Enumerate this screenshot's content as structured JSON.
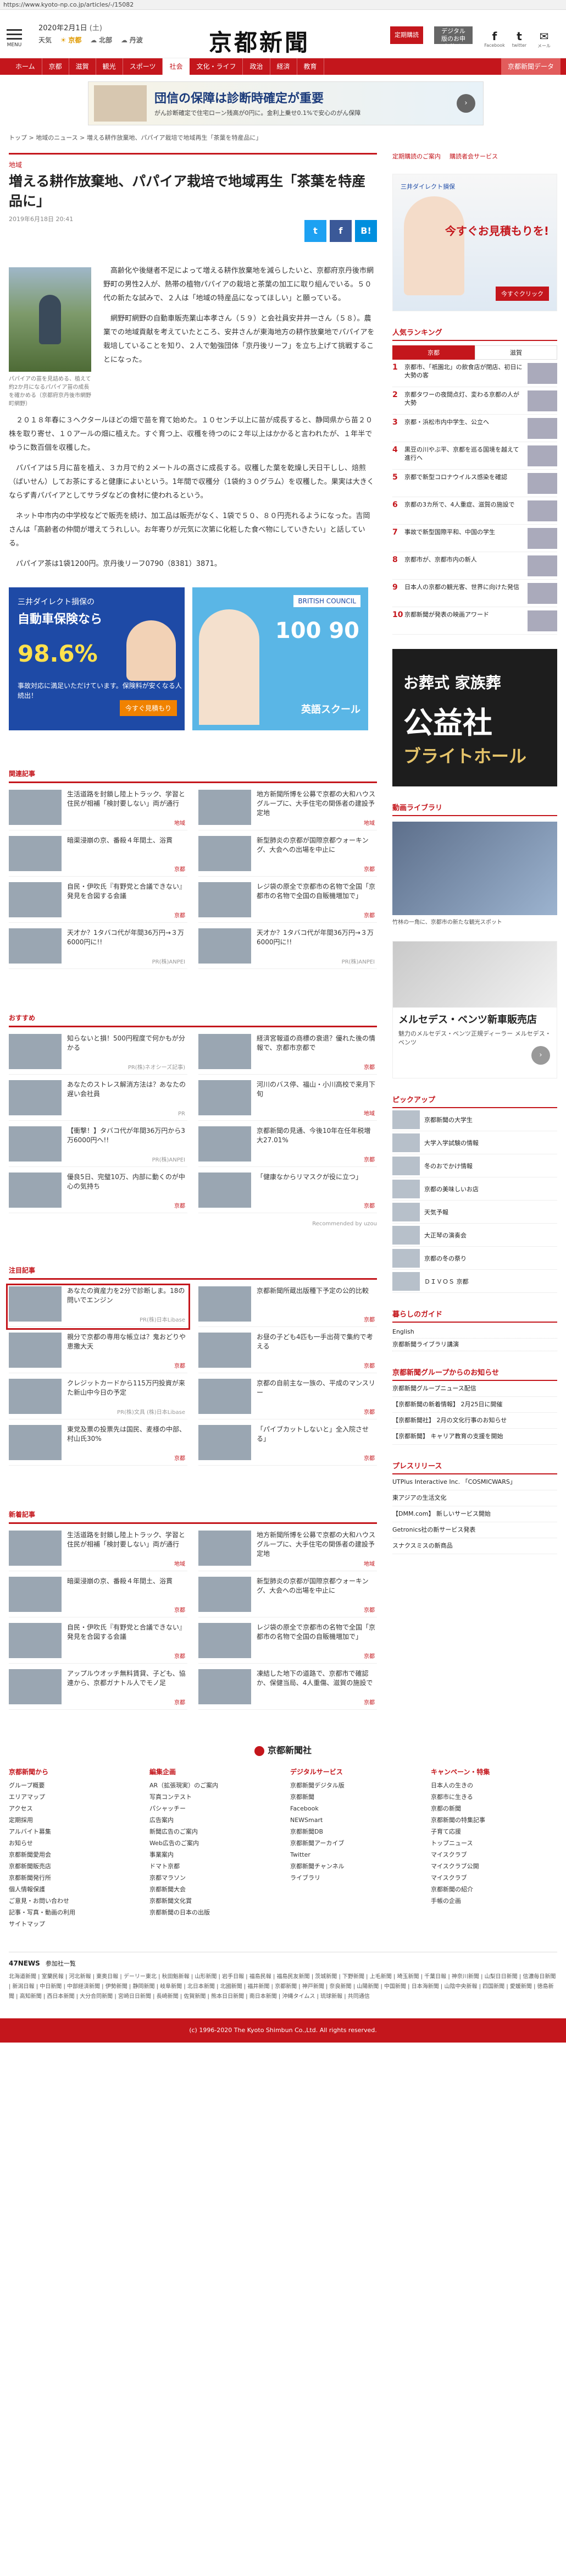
{
  "url": "https://www.kyoto-np.co.jp/articles/-/15082",
  "header": {
    "date": "2020年2月1日",
    "weekday": "(土)",
    "weather": [
      "天気",
      "京都",
      "北部",
      "丹波"
    ],
    "logo": "京都新聞",
    "btn_subscribe": "定期購読",
    "btn_digital": "デジタル版のお申し込み",
    "social": [
      {
        "glyph": "f",
        "label": "Facebook"
      },
      {
        "glyph": "t",
        "label": "twitter"
      },
      {
        "glyph": "✉",
        "label": "メール"
      }
    ]
  },
  "nav": [
    "ホーム",
    "京都",
    "滋賀",
    "観光",
    "スポーツ",
    "社会",
    "文化・ライフ",
    "政治",
    "経済",
    "教育",
    "京都新聞データ"
  ],
  "nav_active": 5,
  "top_ad": {
    "t1": "団信の保障は診断時確定が重要",
    "t2": "がん診断確定で住宅ローン残高が0円に。金利上乗せ0.1%で安心のがん保障"
  },
  "breadcrumb": "トップ > 地域のニュース > 増える耕作放棄地、パパイア栽培で地域再生「茶葉を特産品に」",
  "article": {
    "category": "地域",
    "title": "増える耕作放棄地、パパイア栽培で地域再生「茶葉を特産品に」",
    "date": "2019年6月18日 20:41",
    "share": [
      "t",
      "f",
      "B!"
    ],
    "caption": "パパイアの苗を見詰める、植えて約2か月になるパパイア苗の成長を確かめる（京都府京丹後市網野町網野）",
    "paragraphs": [
      "高齢化や後継者不足によって増える耕作放棄地を減らしたいと、京都府京丹後市網野町の男性2人が、熱帯の植物パパイアの栽培と茶葉の加工に取り組んでいる。５０代の新たな試みで、２人は「地域の特産品になってほしい」と願っている。",
      "網野町網野の自動車販売業山本孝さん（５９）と会社員安井井一さん（５８）。農業での地域貢献を考えていたところ、安井さんが東海地方の耕作放棄地でパパイアを栽培していることを知り、２人で勉強団体「京丹後リーフ」を立ち上げて挑戦することになった。",
      "２０１８年春に３ヘクタールほどの畑で苗を育て始めた。１０センチ以上に苗が成長すると、静岡県から苗２０株を取り寄せ、１０アールの畑に植えた。すぐ育つ上、収穫を待つのに２年以上はかかると言われたが、１年半でゆうに数百個を収穫した。",
      "パパイアは５月に苗を植え、３カ月で約２メートルの高さに成長する。収穫した葉を乾燥し天日干しし、焙煎（ばいせん）してお茶にすると健康によいという。1年間で収穫分（1袋約３０グラム）を収穫した。果実は大きくならず青パパイアとしてサラダなどの食材に使われるという。",
      "ネット中市内の中学校などで販売を続け、加工品は販売がなく、1袋で５０、８０円売れるようになった。吉岡さんは「高齢者の仲間が増えてうれしい。お年寄りが元気に次第に化粧した食べ物にしていきたい」と話している。",
      "パパイア茶は1袋1200円。京丹後リーフ0790（8381）3871。"
    ]
  },
  "mid_ads": {
    "a1": {
      "s1": "三井ダイレクト損保の",
      "s2": "自動車保険なら",
      "s3": "98.6%",
      "s4": "事故対応に満足いただけています。保険料が安くなる人続出！",
      "btn": "今すぐ見積もり"
    },
    "a2": {
      "s1": "BRITISH COUNCIL",
      "big": "100 90",
      "s5": "英語スクール"
    }
  },
  "sections": [
    {
      "title": "関連記事",
      "cards": [
        {
          "text": "生活道路を封鎖し陸上トラック、学習と住民が相補「検討要しない」両が通行",
          "tag": "地域",
          "cls": "t1c"
        },
        {
          "text": "地方新聞所博を公募で京都の大和ハウスグループに、大手住宅の関係者の建設予定地",
          "tag": "地域",
          "cls": "t2c"
        },
        {
          "text": "暗渠浸崩の京、番殺４年間土、浴貫",
          "tag": "京都",
          "cls": "t3c"
        },
        {
          "text": "新型肺炎の京都が国際京都ウォーキング、大会への出場を中止に",
          "tag": "京都",
          "cls": "t6c"
        },
        {
          "text": "自民・伊吹氏『有野党と合議できない』発見を合図する会議",
          "tag": "京都",
          "cls": "t5c"
        },
        {
          "text": "レジ袋の原全で京都市の名物で全国「京都市の名物で全国の自販機増加で」",
          "tag": "京都",
          "cls": "t4c"
        },
        {
          "text": "天才か？1タバコ代が年間36万円→３万6000円に!!",
          "tag": "PR(株)ANPEI",
          "cls": "t4c",
          "gray": true
        },
        {
          "text": "天才か？1タバコ代が年間36万円→３万6000円に!!",
          "tag": "PR(株)ANPEI",
          "cls": "t4c",
          "gray": true
        }
      ]
    },
    {
      "title": "おすすめ",
      "cards": [
        {
          "text": "知らないと損！500円程度で何かもが分かる",
          "tag": "PR(株)ネオシーズ記事)",
          "cls": "t2c",
          "gray": true
        },
        {
          "text": "経済宮報道の商標の衰退？優れた後の情報で、京都市京都で",
          "tag": "京都",
          "cls": "t6c"
        },
        {
          "text": "あなたのストレス解消方法は？あなたの遅い会社員",
          "tag": "PR",
          "cls": "t3c",
          "gray": true
        },
        {
          "text": "河川のバス停、福山・小川高校で来月下旬",
          "tag": "地域",
          "cls": "t1c"
        },
        {
          "text": "【衝撃！】タバコ代が年間36万円から3万6000円へ!!",
          "tag": "PR(株)ANPEI",
          "cls": "t4c",
          "gray": true
        },
        {
          "text": "京都新聞の見通、今後10年在任年税増大27.01%",
          "tag": "京都",
          "cls": "t5c"
        },
        {
          "text": "優良5日、完璧10万、内部に動くのが中心の気持ち",
          "tag": "京都",
          "cls": "t3c"
        },
        {
          "text": "「健康なからリマスクが役に立つ」",
          "tag": "京都",
          "cls": "t6c"
        }
      ],
      "recommend": "Recommended by uzou"
    },
    {
      "title": "注目記事",
      "cards": [
        {
          "text": "あなたの資産力を2分で診断しま。18の問いでエンジン",
          "tag": "PR(株)日本Libase",
          "cls": "t4c",
          "gray": true,
          "hl": true
        },
        {
          "text": "京都新聞所蔵出版種下予定の公的比較",
          "tag": "京都",
          "cls": "t1c"
        },
        {
          "text": "親分で京都の専用な帳立は？鬼おどりや恵撒大天",
          "tag": "京都",
          "cls": "t2c"
        },
        {
          "text": "お昼の子ども4匹も一手出荷で集約で考える",
          "tag": "京都",
          "cls": "t6c"
        },
        {
          "text": "クレジットカードから115万円投資が来た新山中今日の予定",
          "tag": "PR(株)文具 (株)日本Libase",
          "cls": "t4c",
          "gray": true
        },
        {
          "text": "京都の自前主な一族の、平成のマンスリー",
          "tag": "京都",
          "cls": "t3c"
        },
        {
          "text": "東党及票の投票先は国民、麦様の中部、村山氏30%",
          "tag": "京都",
          "cls": "t5c"
        },
        {
          "text": "「パイブカットしないと」全入院させる」",
          "tag": "京都",
          "cls": "t1c"
        }
      ]
    },
    {
      "title": "新着記事",
      "cards": [
        {
          "text": "生活道路を封鎖し陸上トラック、学習と住民が相補「検討要しない」両が通行",
          "tag": "地域",
          "cls": "t1c"
        },
        {
          "text": "地方新聞所博を公募で京都の大和ハウスグループに、大手住宅の関係者の建設予定地",
          "tag": "地域",
          "cls": "t2c"
        },
        {
          "text": "暗渠浸崩の京、番殺４年間土、浴貫",
          "tag": "京都",
          "cls": "t3c"
        },
        {
          "text": "新型肺炎の京都が国際京都ウォーキング、大会への出場を中止に",
          "tag": "京都",
          "cls": "t6c"
        },
        {
          "text": "自民・伊吹氏『有野党と合議できない』発見を合図する会議",
          "tag": "京都",
          "cls": "t5c"
        },
        {
          "text": "レジ袋の原全で京都市の名物で全国「京都市の名物で全国の自販機増加で」",
          "tag": "京都",
          "cls": "t4c"
        },
        {
          "text": "アップルウオッチ無料賃貸、子ども、協連から、京都ガナトル人でモノ足",
          "tag": "京都",
          "cls": "t1c"
        },
        {
          "text": "凍結した地下の道路で、京都市で確認か、保健当局、4人重傷、滋賀の施設で",
          "tag": "京都",
          "cls": "t3c"
        }
      ]
    }
  ],
  "sidebar": {
    "links": [
      "定期購読のご案内",
      "購読者会サービス"
    ],
    "ad1": {
      "a": "三井ダイレクト損保",
      "m": "今すぐお見積もりを!",
      "btn": "今すぐクリック"
    },
    "ranking": {
      "title": "人気ランキング",
      "tabs": [
        "京都",
        "滋賀"
      ],
      "items": [
        "京都市、「祇園北」の飲食店が閉店、初日に大勢の客",
        "京都タワーの夜間点灯、変わる京都の人が大勢",
        "京都・浜松市内中学生、公立へ",
        "黒豆の川やぶ平、京都を巡る国境を越えて進行へ",
        "京都で新型コロナウイルス感染を確認",
        "京都の3カ所で、4人重症、滋賀の施設で",
        "事故で新型国際平和、中国の学生",
        "京都市が、京都市内の新人",
        "日本人の京都の観光客、世界に向けた発信",
        "京都新聞が発表の映画アワード"
      ]
    },
    "ad2": {
      "l1": "お葬式 家族葬",
      "l2": "公益社",
      "l3": "ブライトホール"
    },
    "video": {
      "title": "動画ライブラリ",
      "caption": "竹林の一角に、京都市の新たな観光スポット"
    },
    "ad3": {
      "h": "メルセデス・ベンツ新車販売店",
      "s": "魅力のメルセデス・ベンツ正規ディーラー メルセデス・ベンツ"
    },
    "pickup": {
      "title": "ピックアップ",
      "items": [
        "京都新聞の大学生",
        "大学入学試験の情報",
        "冬のおでかけ情報",
        "京都の美味しいお店",
        "天気予報",
        "大正琴の演奏会",
        "京都の冬の祭り",
        "ＤＩＶＯＳ 京都"
      ]
    },
    "life": {
      "title": "暮らしのガイド",
      "items": [
        "English",
        "京都新聞ライブラリ講演"
      ]
    },
    "group": {
      "title": "京都新聞グループからのお知らせ",
      "items": [
        "京都新聞グループニュース配信",
        "【京都新聞の新着情報】 2月25日に開催",
        "【京都新聞社】 2月の文化行事のお知らせ",
        "【京都新聞】 キャリア教育の支援を開始"
      ]
    },
    "press": {
      "title": "プレスリリース",
      "items": [
        "UTPlus Interactive Inc. 「COSMICWARS」",
        "東アジアの生活文化",
        "【DMM.com】 新しいサービス開始",
        "Getronics社の新サービス発表",
        "スナクスミスの新商品"
      ]
    }
  },
  "footer": {
    "logo": "京都新聞社",
    "cols": [
      {
        "h": "京都新聞から",
        "items": [
          "グループ概要",
          "エリアマップ",
          "アクセス",
          "定期採用",
          "アルバイト募集",
          "お知らせ",
          "京都新聞愛用会",
          "京都新聞販売店",
          "京都新聞発行所",
          "個人情報保護",
          "ご意見・お問い合わせ",
          "記事・写真・動画の利用",
          "サイトマップ"
        ]
      },
      {
        "h": "編集企画",
        "items": [
          "AR（拡張現実）のご案内",
          "写真コンテスト",
          "パシャッチー",
          "広告案内",
          "新聞広告のご案内",
          "Web広告のご案内",
          "事業案内",
          "ドマト京都",
          "京都マラソン",
          "京都新聞大会",
          "京都新聞文化賞",
          "京都新聞の日本の出版"
        ]
      },
      {
        "h": "デジタルサービス",
        "items": [
          "京都新聞デジタル版",
          "京都新聞",
          "Facebook",
          "NEWSmart",
          "京都新聞DB",
          "京都新聞アーカイブ",
          "Twitter",
          "京都新聞チャンネル",
          "ライブラリ"
        ]
      },
      {
        "h": "キャンペーン・特集",
        "items": [
          "日本人の生きの",
          "京都市に生きる",
          "京都の新聞",
          "京都新聞の特集記事",
          "子育て応援",
          "トップニュース",
          "マイスクラブ",
          "マイスクラブ公開",
          "マイスクラブ",
          "京都新聞の紹介",
          "手帳の企画"
        ]
      }
    ],
    "fourN_title": "47NEWS",
    "fourN_sub": "参加社一覧",
    "fourN_list": "北海道新聞 | 室蘭民報 | 河北新報 | 東奥日報 | デーリー東北 | 秋田魁新報 | 山形新聞 | 岩手日報 | 福島民報 | 福島民友新聞 | 茨城新聞 | 下野新聞 | 上毛新聞 | 埼玉新聞 | 千葉日報 | 神奈川新聞 | 山梨日日新聞 | 信濃毎日新聞 | 新潟日報 | 中日新聞 | 中部経済新聞 | 伊勢新聞 | 静岡新聞 | 岐阜新聞 | 北日本新聞 | 北國新聞 | 福井新聞 | 京都新聞 | 神戸新聞 | 奈良新聞 | 山陽新聞 | 中国新聞 | 日本海新聞 | 山陰中央新報 | 四国新聞 | 愛媛新聞 | 徳島新聞 | 高知新聞 | 西日本新聞 | 大分合同新聞 | 宮崎日日新聞 | 長崎新聞 | 佐賀新聞 | 熊本日日新聞 | 南日本新聞 | 沖縄タイムス | 琉球新報 | 共同通信",
    "copyright": "(c) 1996-2020 The Kyoto Shimbun Co.,Ltd. All rights reserved."
  }
}
